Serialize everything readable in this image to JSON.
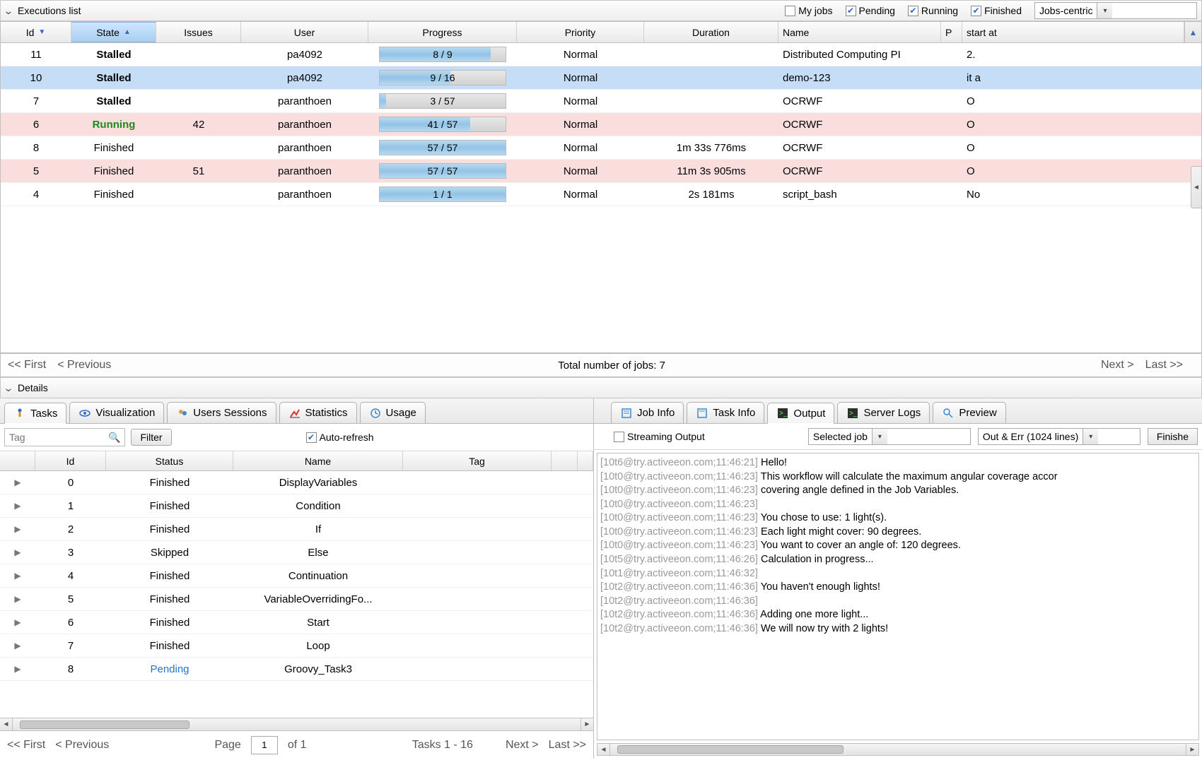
{
  "executions": {
    "title": "Executions list",
    "filters": {
      "my_jobs": "My jobs",
      "pending": "Pending",
      "running": "Running",
      "finished": "Finished",
      "my_jobs_checked": false,
      "pending_checked": true,
      "running_checked": true,
      "finished_checked": true
    },
    "view_selector": "Jobs-centric",
    "columns": {
      "id": "Id",
      "state": "State",
      "issues": "Issues",
      "user": "User",
      "progress": "Progress",
      "priority": "Priority",
      "duration": "Duration",
      "name": "Name",
      "p": "P",
      "start": "start at"
    },
    "rows": [
      {
        "sel": false,
        "err": false,
        "id": "11",
        "state": "Stalled",
        "state_class": "bold",
        "issues": "",
        "user": "pa4092",
        "prog_txt": "8 / 9",
        "prog_pct": 88,
        "priority": "Normal",
        "duration": "",
        "name": "Distributed Computing PI",
        "start": "2."
      },
      {
        "sel": true,
        "err": false,
        "id": "10",
        "state": "Stalled",
        "state_class": "bold",
        "issues": "",
        "user": "pa4092",
        "prog_txt": "9 / 16",
        "prog_pct": 56,
        "priority": "Normal",
        "duration": "",
        "name": "demo-123",
        "start": "it a"
      },
      {
        "sel": false,
        "err": false,
        "id": "7",
        "state": "Stalled",
        "state_class": "bold",
        "issues": "",
        "user": "paranthoen",
        "prog_txt": "3 / 57",
        "prog_pct": 5,
        "priority": "Normal",
        "duration": "",
        "name": "OCRWF",
        "start": "O"
      },
      {
        "sel": false,
        "err": true,
        "id": "6",
        "state": "Running",
        "state_class": "running",
        "issues": "42",
        "user": "paranthoen",
        "prog_txt": "41 / 57",
        "prog_pct": 72,
        "priority": "Normal",
        "duration": "",
        "name": "OCRWF",
        "start": "O"
      },
      {
        "sel": false,
        "err": false,
        "id": "8",
        "state": "Finished",
        "state_class": "",
        "issues": "",
        "user": "paranthoen",
        "prog_txt": "57 / 57",
        "prog_pct": 100,
        "priority": "Normal",
        "duration": "1m 33s 776ms",
        "name": "OCRWF",
        "start": "O"
      },
      {
        "sel": false,
        "err": true,
        "id": "5",
        "state": "Finished",
        "state_class": "",
        "issues": "51",
        "user": "paranthoen",
        "prog_txt": "57 / 57",
        "prog_pct": 100,
        "priority": "Normal",
        "duration": "11m 3s 905ms",
        "name": "OCRWF",
        "start": "O"
      },
      {
        "sel": false,
        "err": false,
        "id": "4",
        "state": "Finished",
        "state_class": "",
        "issues": "",
        "user": "paranthoen",
        "prog_txt": "1 / 1",
        "prog_pct": 100,
        "priority": "Normal",
        "duration": "2s 181ms",
        "name": "script_bash",
        "start": "No"
      }
    ],
    "pager": {
      "first": "<< First",
      "prev": "< Previous",
      "total": "Total number of jobs: 7",
      "next": "Next >",
      "last": "Last >>"
    }
  },
  "details": {
    "title": "Details",
    "left_tabs": {
      "tasks": "Tasks",
      "visualization": "Visualization",
      "users": "Users Sessions",
      "stats": "Statistics",
      "usage": "Usage"
    },
    "left_toolbar": {
      "tag_placeholder": "Tag",
      "filter": "Filter",
      "autorefresh": "Auto-refresh",
      "autorefresh_checked": true
    },
    "tasks_cols": {
      "id": "Id",
      "status": "Status",
      "name": "Name",
      "tag": "Tag"
    },
    "tasks_rows": [
      {
        "id": "0",
        "status": "Finished",
        "name": "DisplayVariables"
      },
      {
        "id": "1",
        "status": "Finished",
        "name": "Condition"
      },
      {
        "id": "2",
        "status": "Finished",
        "name": "If"
      },
      {
        "id": "3",
        "status": "Skipped",
        "name": "Else"
      },
      {
        "id": "4",
        "status": "Finished",
        "name": "Continuation"
      },
      {
        "id": "5",
        "status": "Finished",
        "name": "VariableOverridingFo..."
      },
      {
        "id": "6",
        "status": "Finished",
        "name": "Start"
      },
      {
        "id": "7",
        "status": "Finished",
        "name": "Loop"
      },
      {
        "id": "8",
        "status": "Pending",
        "name": "Groovy_Task3",
        "pending": true
      }
    ],
    "tasks_footer": {
      "first": "<< First",
      "prev": "< Previous",
      "page_label": "Page",
      "page_value": "1",
      "page_of": "of 1",
      "range": "Tasks 1 - 16",
      "next": "Next >",
      "last": "Last >>"
    },
    "right_tabs": {
      "job_info": "Job Info",
      "task_info": "Task Info",
      "output": "Output",
      "server_logs": "Server Logs",
      "preview": "Preview"
    },
    "right_toolbar": {
      "streaming": "Streaming Output",
      "streaming_checked": false,
      "scope": "Selected job",
      "lines": "Out & Err (1024 lines)",
      "finish_btn": "Finishe"
    },
    "output": [
      {
        "ts": "[10t6@try.activeeon.com;11:46:21]",
        "msg": "Hello!"
      },
      {
        "ts": "[10t0@try.activeeon.com;11:46:23]",
        "msg": "This workflow will calculate the maximum angular coverage accor"
      },
      {
        "ts": "[10t0@try.activeeon.com;11:46:23]",
        "msg": "covering angle defined in the Job Variables."
      },
      {
        "ts": "[10t0@try.activeeon.com;11:46:23]",
        "msg": ""
      },
      {
        "ts": "[10t0@try.activeeon.com;11:46:23]",
        "msg": "You chose to use: 1 light(s)."
      },
      {
        "ts": "[10t0@try.activeeon.com;11:46:23]",
        "msg": "Each light might cover: 90 degrees."
      },
      {
        "ts": "[10t0@try.activeeon.com;11:46:23]",
        "msg": "You want to cover an angle of: 120 degrees."
      },
      {
        "ts": "[10t5@try.activeeon.com;11:46:26]",
        "msg": "Calculation in progress..."
      },
      {
        "ts": "[10t1@try.activeeon.com;11:46:32]",
        "msg": ""
      },
      {
        "ts": "[10t2@try.activeeon.com;11:46:36]",
        "msg": "You haven't enough lights!"
      },
      {
        "ts": "[10t2@try.activeeon.com;11:46:36]",
        "msg": ""
      },
      {
        "ts": "[10t2@try.activeeon.com;11:46:36]",
        "msg": "Adding one more light..."
      },
      {
        "ts": "[10t2@try.activeeon.com;11:46:36]",
        "msg": "We will now try with 2 lights!"
      }
    ]
  }
}
